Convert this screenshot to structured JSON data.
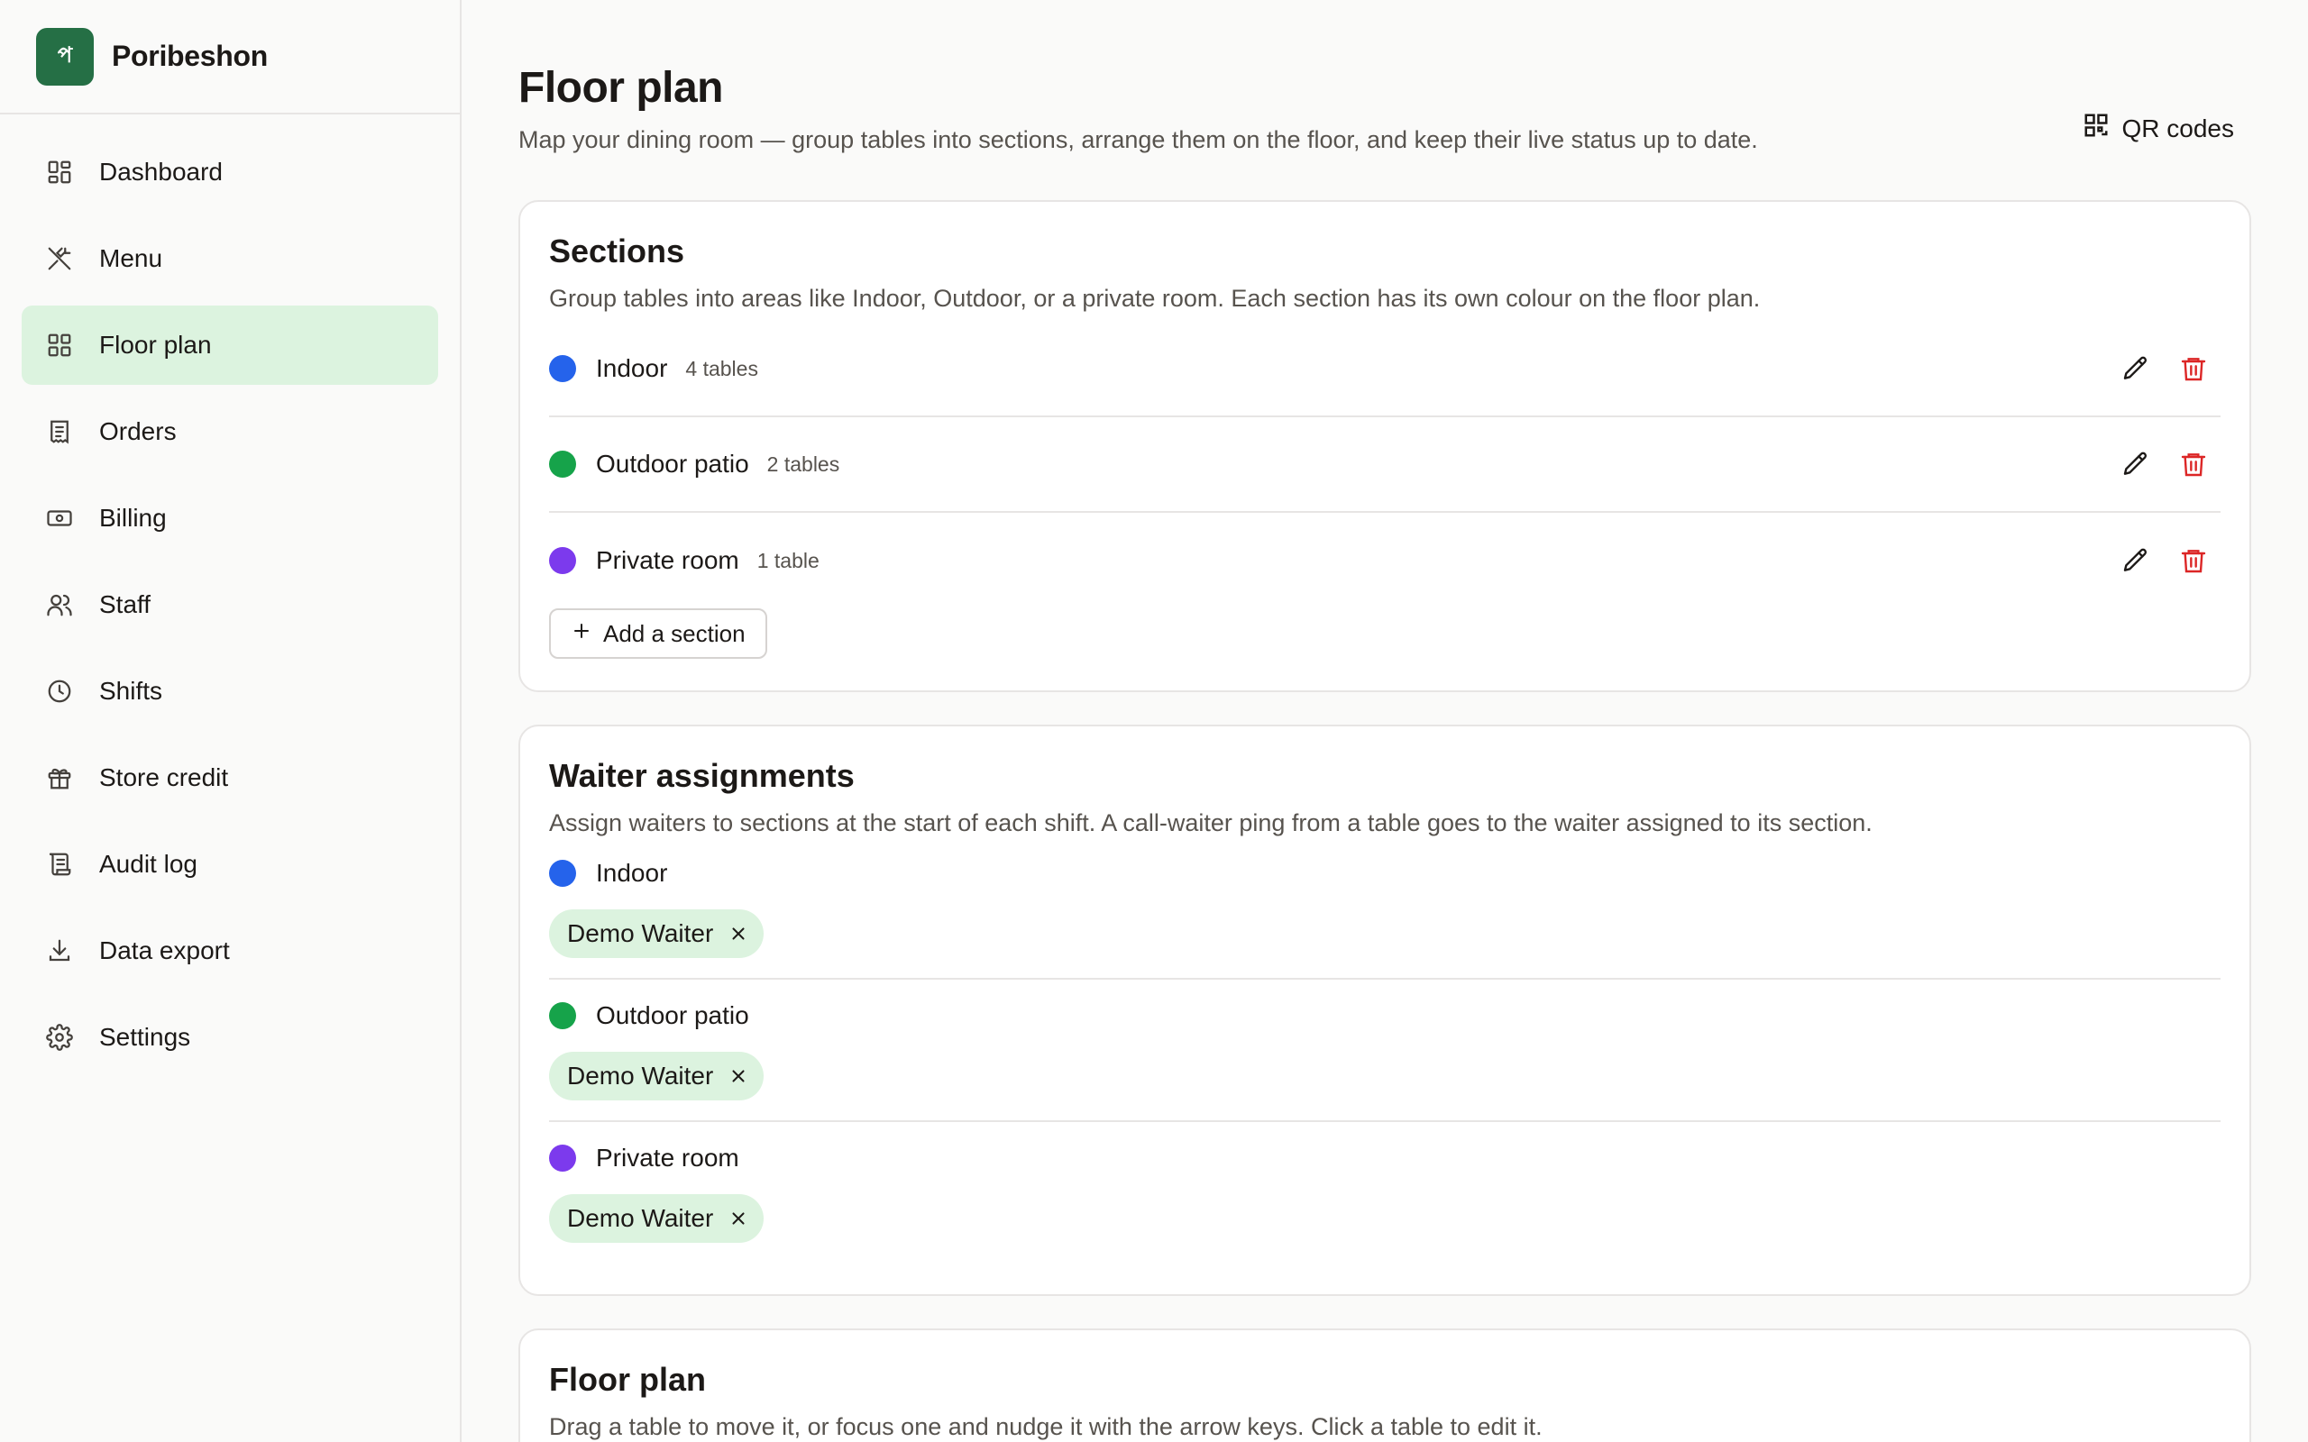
{
  "brand": {
    "logo_glyph": "প",
    "name": "Poribeshon"
  },
  "nav": [
    {
      "label": "Dashboard",
      "icon": "dashboard-icon",
      "active": false
    },
    {
      "label": "Menu",
      "icon": "utensils-icon",
      "active": false
    },
    {
      "label": "Floor plan",
      "icon": "floor-plan-icon",
      "active": true
    },
    {
      "label": "Orders",
      "icon": "receipt-icon",
      "active": false
    },
    {
      "label": "Billing",
      "icon": "banknote-icon",
      "active": false
    },
    {
      "label": "Staff",
      "icon": "users-icon",
      "active": false
    },
    {
      "label": "Shifts",
      "icon": "clock-icon",
      "active": false
    },
    {
      "label": "Store credit",
      "icon": "gift-icon",
      "active": false
    },
    {
      "label": "Audit log",
      "icon": "scroll-icon",
      "active": false
    },
    {
      "label": "Data export",
      "icon": "download-icon",
      "active": false
    },
    {
      "label": "Settings",
      "icon": "gear-icon",
      "active": false
    }
  ],
  "header": {
    "title": "Floor plan",
    "description": "Map your dining room — group tables into sections, arrange them on the floor, and keep their live status up to date.",
    "qr_label": "QR codes"
  },
  "sections_card": {
    "title": "Sections",
    "description": "Group tables into areas like Indoor, Outdoor, or a private room. Each section has its own colour on the floor plan.",
    "items": [
      {
        "name": "Indoor",
        "count": "4 tables",
        "color": "#2563eb"
      },
      {
        "name": "Outdoor patio",
        "count": "2 tables",
        "color": "#16a34a"
      },
      {
        "name": "Private room",
        "count": "1 table",
        "color": "#7c3aed"
      }
    ],
    "add_label": "Add a section"
  },
  "waiters_card": {
    "title": "Waiter assignments",
    "description": "Assign waiters to sections at the start of each shift. A call-waiter ping from a table goes to the waiter assigned to its section.",
    "groups": [
      {
        "name": "Indoor",
        "color": "#2563eb",
        "waiter": "Demo Waiter"
      },
      {
        "name": "Outdoor patio",
        "color": "#16a34a",
        "waiter": "Demo Waiter"
      },
      {
        "name": "Private room",
        "color": "#7c3aed",
        "waiter": "Demo Waiter"
      }
    ]
  },
  "floor_card": {
    "title": "Floor plan",
    "description": "Drag a table to move it, or focus one and nudge it with the arrow keys. Click a table to edit it."
  },
  "colors": {
    "accent": "#256f45",
    "active_bg": "#dcf3df",
    "danger": "#dc2626"
  }
}
